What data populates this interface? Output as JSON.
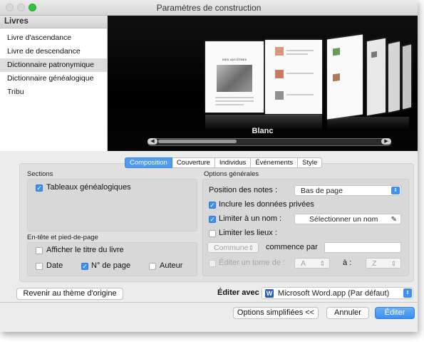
{
  "window": {
    "title": "Paramètres de construction"
  },
  "sidebar": {
    "header": "Livres",
    "items": [
      {
        "label": "Livre d'ascendance"
      },
      {
        "label": "Livre de descendance"
      },
      {
        "label": "Dictionnaire patronymique",
        "selected": true
      },
      {
        "label": "Dictionnaire généalogique"
      },
      {
        "label": "Tribu"
      }
    ]
  },
  "preview": {
    "caption": "Blanc",
    "book_heading": "MES ANCÊTRES"
  },
  "tabs": [
    "Composition",
    "Couverture",
    "Individus",
    "Événements",
    "Style"
  ],
  "sections": {
    "title": "Sections",
    "tableaux": "Tableaux généalogiques"
  },
  "header_footer": {
    "title": "En-tête et pied-de-page",
    "show_title": "Afficher le titre du livre",
    "date": "Date",
    "page_no": "N° de page",
    "author": "Auteur"
  },
  "general": {
    "title": "Options générales",
    "notes_label": "Position des notes :",
    "notes_value": "Bas de page",
    "private": "Inclure les données privées",
    "limit_name": "Limiter à un nom :",
    "select_name": "Sélectionner un nom",
    "limit_places": "Limiter les lieux :",
    "commune": "Commune",
    "commence": "commence par",
    "edit_tome": "Éditer un tome de :",
    "tome_from": "A",
    "a_label": "à :",
    "tome_to": "Z"
  },
  "bottom": {
    "reset": "Revenir au thème d'origine",
    "edit_with": "Éditer avec :",
    "app": "Microsoft Word.app (Par défaut)",
    "simplified": "Options simplifiées <<",
    "cancel": "Annuler",
    "edit": "Éditer"
  },
  "colors": {
    "accent": "#3d8ff0",
    "word": "#2b5fb4"
  }
}
